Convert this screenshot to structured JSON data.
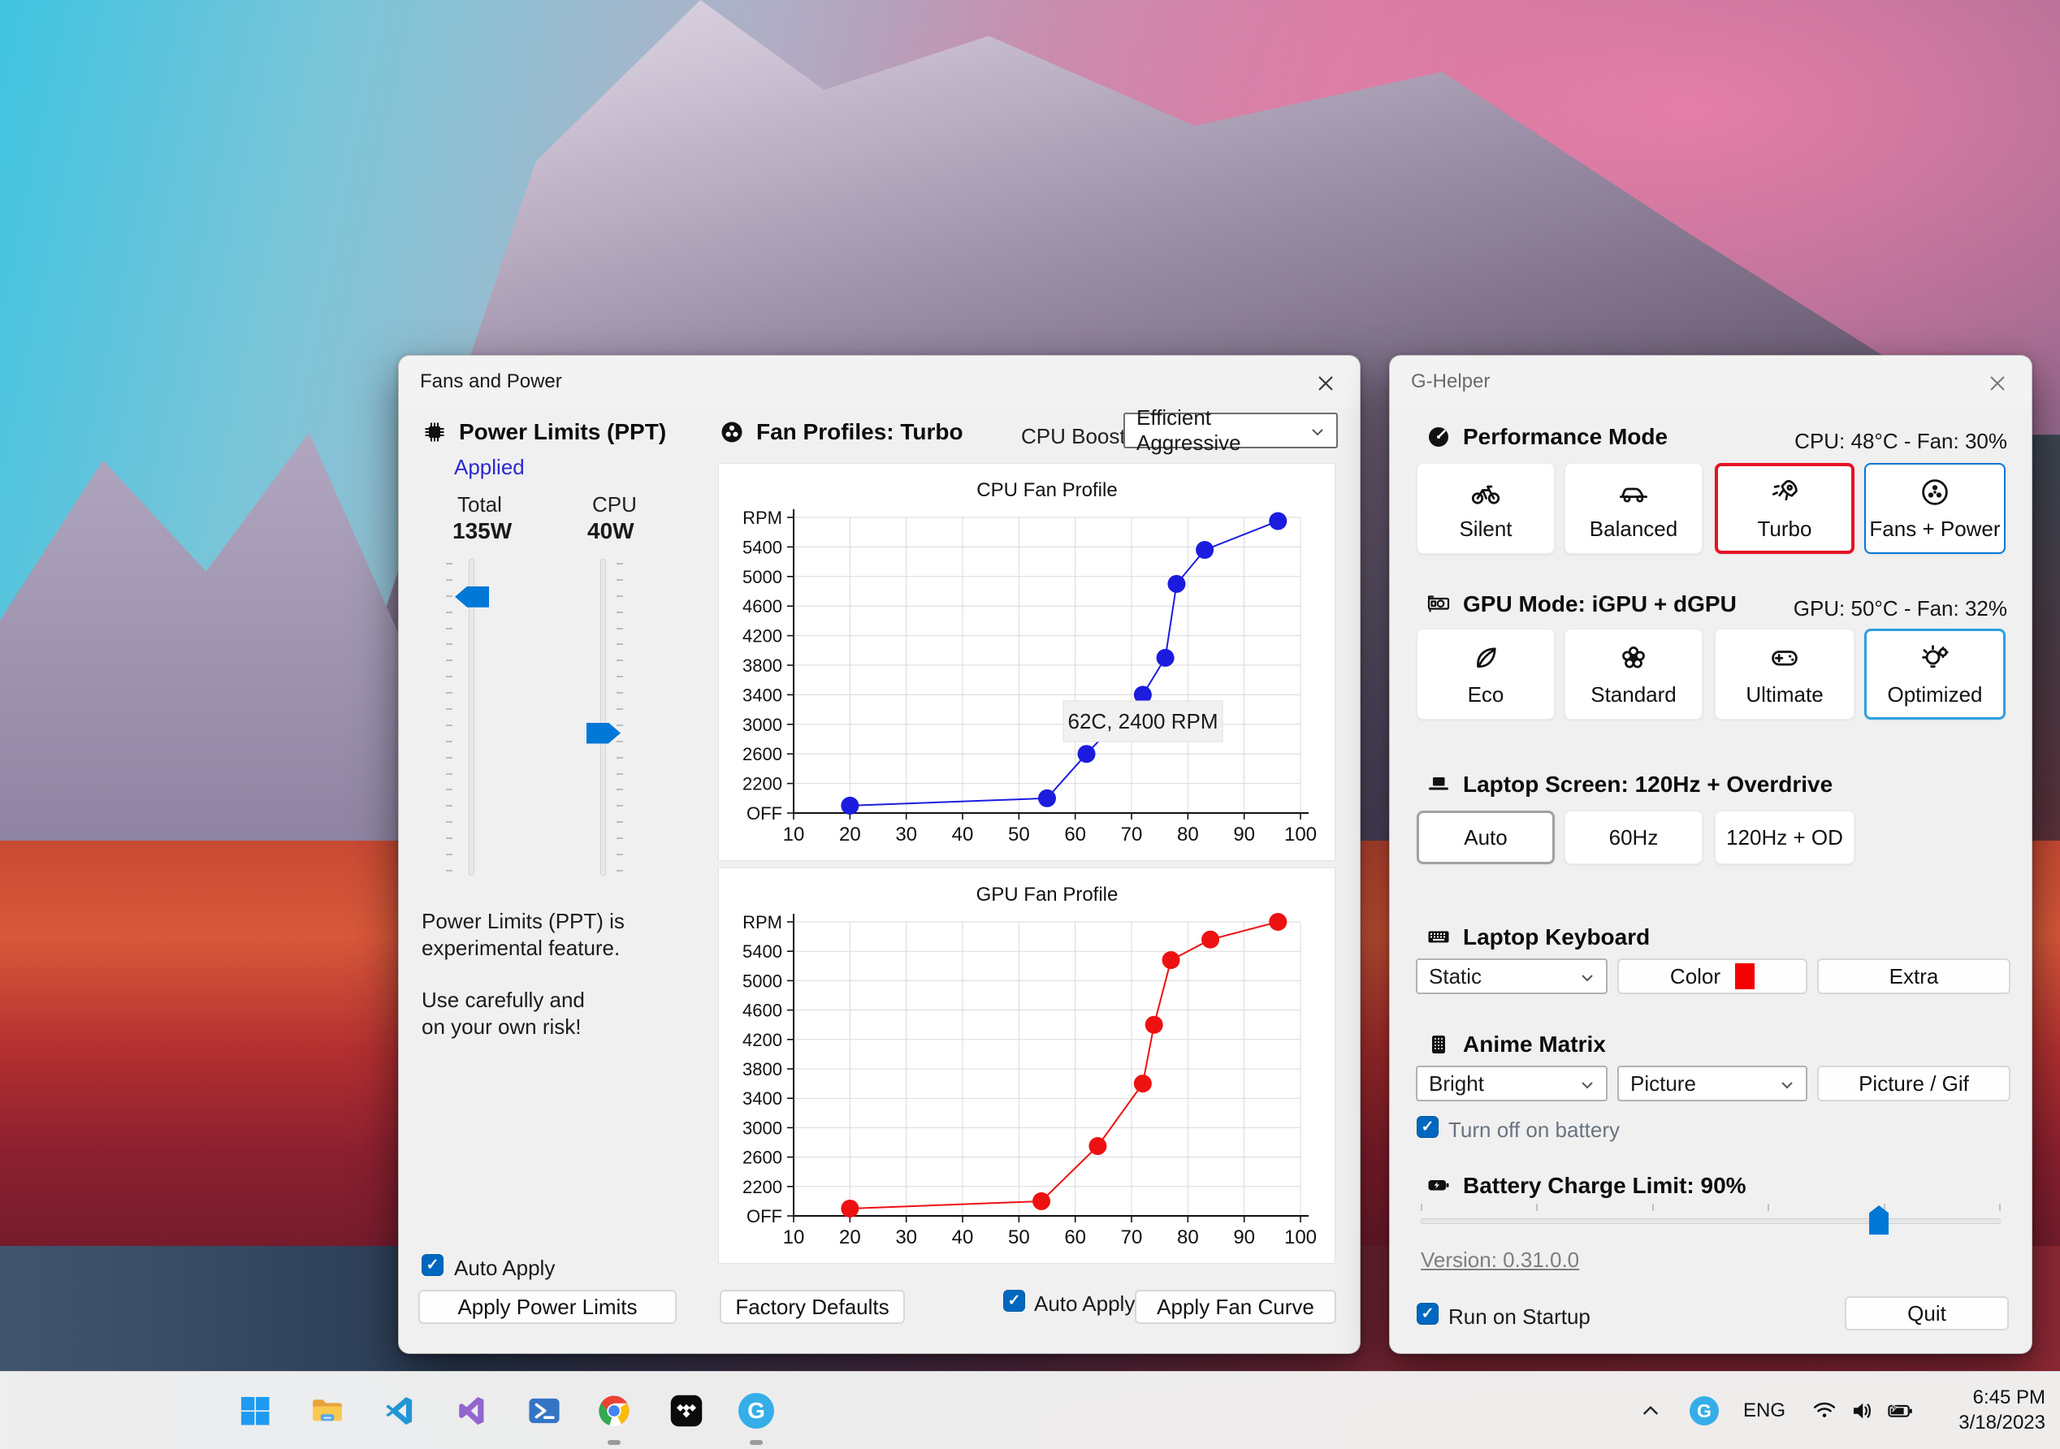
{
  "fans": {
    "title": "Fans and Power",
    "power_limits": {
      "header": "Power Limits (PPT)",
      "status": "Applied",
      "total_label": "Total",
      "total_value": "135W",
      "cpu_label": "CPU",
      "cpu_value": "40W",
      "total_slider_pos_pct": 12,
      "cpu_slider_pos_pct": 55,
      "note_line1": "Power Limits (PPT) is",
      "note_line2": "experimental feature.",
      "note_line3": "Use carefully and",
      "note_line4": "on your own risk!",
      "auto_apply_label": "Auto Apply",
      "auto_apply_checked": true,
      "apply_button_label": "Apply Power Limits"
    },
    "fan_profiles": {
      "header": "Fan Profiles: Turbo",
      "cpu_boost_label": "CPU Boost",
      "cpu_boost_value": "Efficient Aggressive",
      "factory_defaults_label": "Factory Defaults",
      "auto_apply_label": "Auto Apply",
      "auto_apply_checked": true,
      "apply_fan_curve_label": "Apply Fan Curve"
    }
  },
  "chart_data": [
    {
      "type": "line",
      "title": "CPU Fan Profile",
      "line_color": "#1c1cdf",
      "x": [
        20,
        55,
        62,
        72,
        76,
        78,
        83,
        96
      ],
      "y": [
        1900,
        2000,
        2600,
        3400,
        3900,
        4900,
        5360,
        5750
      ],
      "x_ticks": [
        10,
        20,
        30,
        40,
        50,
        60,
        70,
        80,
        90,
        100
      ],
      "y_tick_labels": [
        "OFF",
        "2200",
        "2600",
        "3000",
        "3400",
        "3800",
        "4200",
        "4600",
        "5000",
        "5400",
        "RPM"
      ],
      "y_value_range": [
        1800,
        5800
      ],
      "xlim": [
        10,
        100
      ],
      "grid": true,
      "legend": "none",
      "tooltip": "62C, 2400 RPM"
    },
    {
      "type": "line",
      "title": "GPU Fan Profile",
      "line_color": "#ee1111",
      "x": [
        20,
        54,
        64,
        72,
        74,
        77,
        84,
        96
      ],
      "y": [
        1900,
        2000,
        2750,
        3600,
        4400,
        5280,
        5560,
        5800
      ],
      "x_ticks": [
        10,
        20,
        30,
        40,
        50,
        60,
        70,
        80,
        90,
        100
      ],
      "y_tick_labels": [
        "OFF",
        "2200",
        "2600",
        "3000",
        "3400",
        "3800",
        "4200",
        "4600",
        "5000",
        "5400",
        "RPM"
      ],
      "y_value_range": [
        1800,
        5800
      ],
      "xlim": [
        10,
        100
      ],
      "grid": true,
      "legend": "none",
      "tooltip": null
    }
  ],
  "ghelper": {
    "title": "G-Helper",
    "performance_mode": {
      "header": "Performance Mode",
      "status": "CPU: 48°C -  Fan: 30%",
      "buttons": [
        {
          "label": "Silent",
          "icon": "bicycle-icon",
          "selected": false
        },
        {
          "label": "Balanced",
          "icon": "car-icon",
          "selected": false
        },
        {
          "label": "Turbo",
          "icon": "rocket-icon",
          "selected": true,
          "selection_color": "#e81123"
        },
        {
          "label": "Fans + Power",
          "icon": "fan-icon",
          "selected": true,
          "selection_color": "#0078d7"
        }
      ]
    },
    "gpu_mode": {
      "header": "GPU Mode: iGPU + dGPU",
      "status": "GPU: 50°C -  Fan: 32%",
      "buttons": [
        {
          "label": "Eco",
          "icon": "leaf-icon",
          "selected": false
        },
        {
          "label": "Standard",
          "icon": "flower-icon",
          "selected": false
        },
        {
          "label": "Ultimate",
          "icon": "gamepad-icon",
          "selected": false
        },
        {
          "label": "Optimized",
          "icon": "lightbulb-gear-icon",
          "selected": true,
          "selection_color": "#2da0e0"
        }
      ]
    },
    "laptop_screen": {
      "header": "Laptop Screen: 120Hz + Overdrive",
      "buttons": [
        {
          "label": "Auto",
          "selected": true,
          "selection_color": "#a2a2a2"
        },
        {
          "label": "60Hz",
          "selected": false
        },
        {
          "label": "120Hz + OD",
          "selected": false
        }
      ]
    },
    "laptop_keyboard": {
      "header": "Laptop Keyboard",
      "mode_value": "Static",
      "color_button_label": "Color",
      "color_swatch": "#f50000",
      "extra_button_label": "Extra"
    },
    "anime_matrix": {
      "header": "Anime Matrix",
      "brightness_value": "Bright",
      "mode_value": "Picture",
      "picture_button_label": "Picture / Gif",
      "turn_off_label": "Turn off on battery",
      "turn_off_checked": true
    },
    "battery": {
      "header": "Battery Charge Limit: 90%",
      "value_percent": 90,
      "thumb_pos_pct": 79
    },
    "version_link": "Version: 0.31.0.0",
    "run_on_startup_label": "Run on Startup",
    "run_on_startup_checked": true,
    "quit_label": "Quit"
  },
  "taskbar": {
    "icons": [
      "windows-start",
      "file-explorer",
      "vscode",
      "visual-studio",
      "powershell",
      "chrome",
      "tidal",
      "ghelper"
    ],
    "running": [
      "chrome",
      "ghelper"
    ],
    "ghelper_glyph": "G",
    "tray": {
      "language": "ENG",
      "time": "6:45 PM",
      "date": "3/18/2023"
    }
  },
  "colors": {
    "accent_blue": "#0078d7",
    "selection_red": "#e81123",
    "selection_light_blue": "#2da0e0",
    "chart_cpu": "#1c1cdf",
    "chart_gpu": "#ee1111",
    "keyboard_swatch": "#f50000"
  }
}
